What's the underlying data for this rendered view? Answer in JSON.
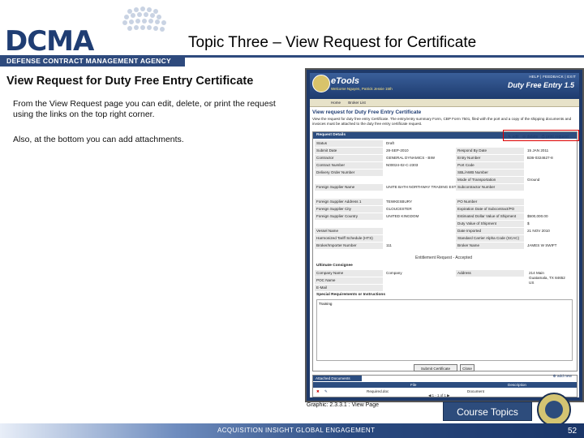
{
  "header": {
    "logo": "DCMA",
    "agency": "DEFENSE CONTRACT MANAGEMENT AGENCY",
    "title": "Topic Three – View Request for Certificate"
  },
  "main": {
    "heading": "View Request for Duty Free Entry Certificate",
    "paragraph1": "From the View Request page you can edit, delete, or print the request using the links on the top right corner.",
    "paragraph2": "Also, at the bottom you can add attachments."
  },
  "screenshot": {
    "app_name": "eTools",
    "welcome": "Welcome Nguyen, Patrick  Jessie 15th",
    "top_links": "HELP  |  FEEDBACK  |  EXIT",
    "module": "Duty Free Entry 1.5",
    "nav": [
      "Home",
      "Broker List"
    ],
    "page_title": "View request for Duty Free Entry Certificate",
    "description": "View the request for duty free entry Certificate. The entry/entry summary Form, CBP Form 7501, filed with the port and a copy of the shipping documents and invoices must be attached to the duty free entry certificate request.",
    "section_title": "Request Details",
    "actions": {
      "edit": "edit",
      "delete": "delete",
      "print": "print request"
    },
    "left_fields": [
      {
        "label": "Status",
        "value": "Draft"
      },
      {
        "label": "Submit Date",
        "value": "28-SEP-2010"
      },
      {
        "label": "Contractor",
        "value": "GENERAL DYNAMICS - BIW"
      },
      {
        "label": "Contract Number",
        "value": "N00024-02-C-2303"
      },
      {
        "label": "Delivery Order Number",
        "value": ""
      },
      {
        "label": "Foreign Supplier Name",
        "value": "UNITE BATH NORTHWAY TRADING EST"
      },
      {
        "label": "Foreign Supplier Address 1",
        "value": "TEWKESBURY"
      },
      {
        "label": "Foreign Supplier City",
        "value": "GLOUCESTER"
      },
      {
        "label": "Foreign Supplier Country",
        "value": "UNITED KINGDOM"
      },
      {
        "label": "Vessel Name",
        "value": ""
      },
      {
        "label": "Harmonized Tariff Schedule (HTS)",
        "value": ""
      },
      {
        "label": "Broker/Importer Number",
        "value": "111"
      }
    ],
    "right_fields": [
      {
        "label": "Respond By Date",
        "value": "15 JAN 2011"
      },
      {
        "label": "Entry Number",
        "value": "B36-0324627-8"
      },
      {
        "label": "Port Code",
        "value": ""
      },
      {
        "label": "SBL/AWB Number",
        "value": ""
      },
      {
        "label": "Mode of Transportation",
        "value": "Ground"
      },
      {
        "label": "Subcontractor Number",
        "value": ""
      },
      {
        "label": "PO Number",
        "value": ""
      },
      {
        "label": "Expiration Date of Subcontract/PO",
        "value": ""
      },
      {
        "label": "Estimated Dollar Value of Shipment",
        "value": "$500,000.00"
      },
      {
        "label": "Duty Value of Shipment",
        "value": "$"
      },
      {
        "label": "Date Imported",
        "value": "21 NOV 2010"
      },
      {
        "label": "Standard Carrier Alpha Code (SCAC)",
        "value": ""
      },
      {
        "label": "Broker Name",
        "value": "JAMES W SWIFT"
      }
    ],
    "accepted": "Entitlement Request - Accepted",
    "consignee_title": "Ultimate Consignee",
    "consignee_left": [
      {
        "label": "Company Name",
        "value": "Company"
      },
      {
        "label": "POC Name",
        "value": ""
      },
      {
        "label": "E-Mail",
        "value": ""
      }
    ],
    "consignee_address_label": "Address",
    "consignee_address": "214 Main\nGuatamala, TX 84652\nUS",
    "special_title": "Special Requirements or Instructions",
    "special_text": "Training",
    "submit_btn": "Submit Certificate",
    "close_btn": "Close",
    "attach_title": "Attached Documents",
    "add_new": "add new",
    "attach_cols": {
      "file": "File",
      "desc": "Description"
    },
    "attach_row": {
      "file": "Required.doc",
      "desc": "Document"
    },
    "pager": "1 - 1 of 1"
  },
  "footer": {
    "caption": "Graphic: 2.3.3.1 : View Page",
    "course_button": "Course Topics",
    "tagline": "ACQUISITION  INSIGHT  GLOBAL ENGAGEMENT",
    "page_number": "52"
  },
  "colors": {
    "brand_navy": "#1f3d73",
    "highlight_red": "#dd0000"
  }
}
